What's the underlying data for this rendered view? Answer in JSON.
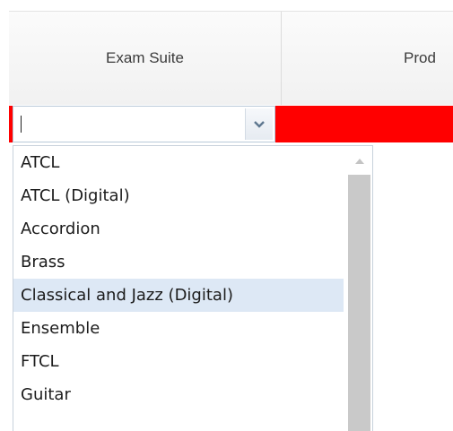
{
  "grid": {
    "columns": [
      "Exam Suite",
      "Prod"
    ]
  },
  "filter": {
    "exam_suite_value": "",
    "dropdown_icon": "chevron-down-icon"
  },
  "dropdown": {
    "items": [
      "ATCL",
      "ATCL (Digital)",
      "Accordion",
      "Brass",
      "Classical and Jazz (Digital)",
      "Ensemble",
      "FTCL",
      "Guitar"
    ],
    "highlighted": "Classical and Jazz (Digital)",
    "scroll_up_icon": "scroll-up-arrow-icon"
  },
  "colors": {
    "filter_row_bg": "#ff0000",
    "highlight_bg": "#dde8f5"
  }
}
